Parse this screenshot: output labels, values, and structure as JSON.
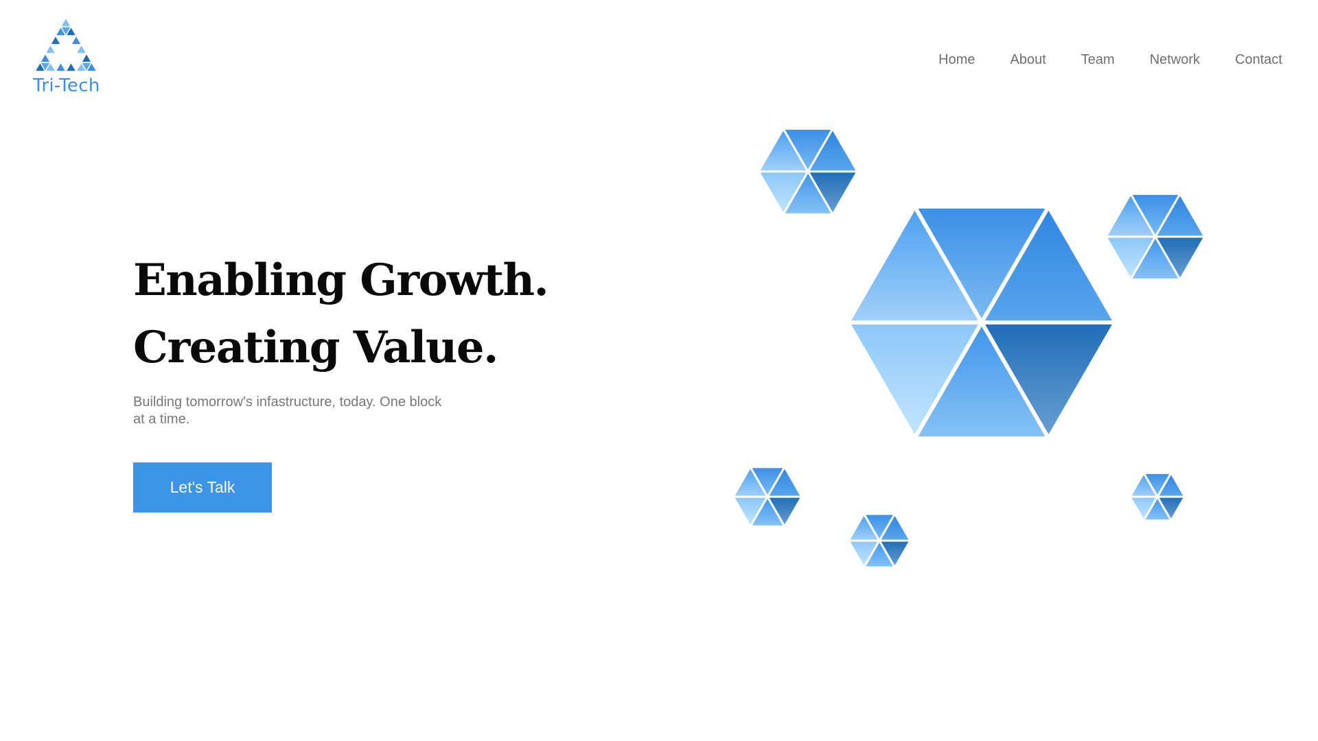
{
  "brand": {
    "name": "Tri-Tech",
    "icon": "triangle-logo-icon",
    "colors": {
      "primary": "#3d95ea",
      "logo_text": "#3b8fe0",
      "light": "#bfe2ff",
      "dark": "#1e6fc2"
    }
  },
  "nav": {
    "items": [
      {
        "label": "Home"
      },
      {
        "label": "About"
      },
      {
        "label": "Team"
      },
      {
        "label": "Network"
      },
      {
        "label": "Contact"
      }
    ]
  },
  "hero": {
    "headline_line1": "Enabling Growth.",
    "headline_line2": "Creating Value.",
    "subtitle": "Building tomorrow's infastructure, today. One block at a time.",
    "cta_label": "Let's Talk"
  },
  "illustration": {
    "icon": "hexagon-cluster-icon"
  }
}
